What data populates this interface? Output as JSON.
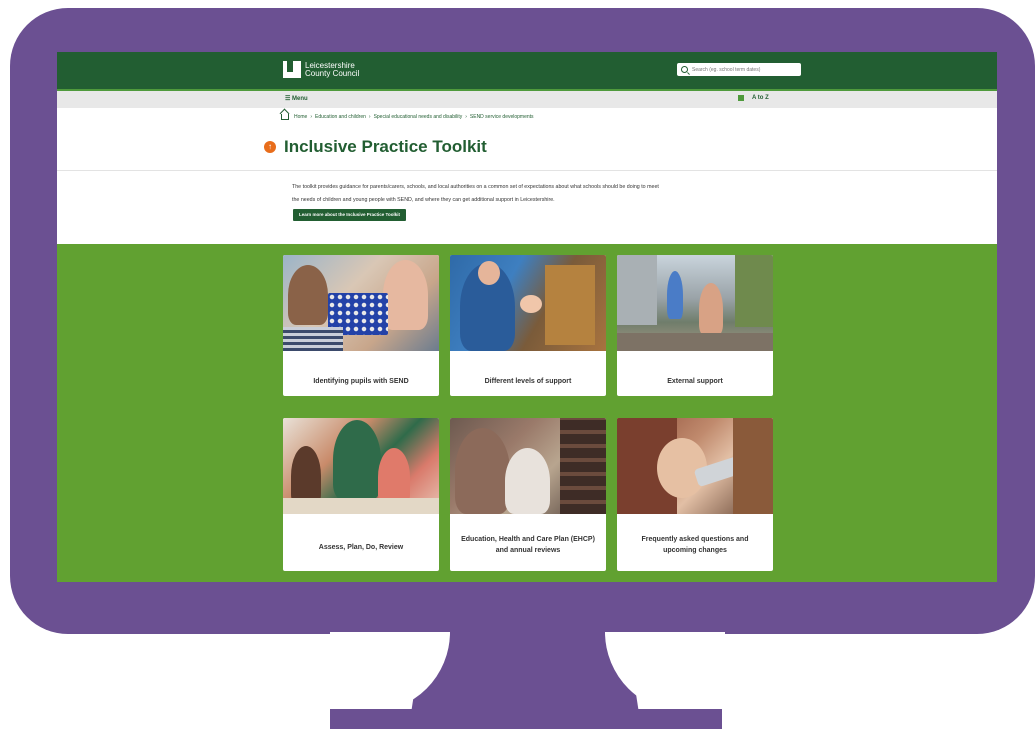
{
  "site": {
    "logo_line1": "Leicestershire",
    "logo_line2": "County Council",
    "search_placeholder": "Search (eg. school term dates)"
  },
  "menubar": {
    "menu_label": "☰ Menu",
    "atoz_label": "A to Z"
  },
  "breadcrumb": {
    "items": [
      "Home",
      "Education and children",
      "Special educational needs and disability",
      "SEND service developments"
    ],
    "separator": "›"
  },
  "page": {
    "title": "Inclusive Practice Toolkit",
    "title_icon_glyph": "↑",
    "intro_line1": "The toolkit provides guidance for parents/carers, schools, and local authorities on a common set of expectations about what schools should be doing to meet",
    "intro_line2": "the needs of children and young people with SEND, and where they can get additional support in Leicestershire.",
    "learn_button": "Learn more about the Inclusive Practice Toolkit"
  },
  "cards": [
    {
      "label_line1": "Identifying pupils with SEND",
      "label_line2": ""
    },
    {
      "label_line1": "Different levels of support",
      "label_line2": ""
    },
    {
      "label_line1": "External support",
      "label_line2": ""
    },
    {
      "label_line1": "Assess, Plan, Do, Review",
      "label_line2": ""
    },
    {
      "label_line1": "Education, Health and Care Plan (EHCP)",
      "label_line2": "and annual reviews"
    },
    {
      "label_line1": "Frequently asked questions and",
      "label_line2": "upcoming changes"
    }
  ],
  "colors": {
    "frame": "#6b5092",
    "header_green": "#225e32",
    "content_green": "#61a131",
    "accent_orange": "#e86d1b"
  }
}
